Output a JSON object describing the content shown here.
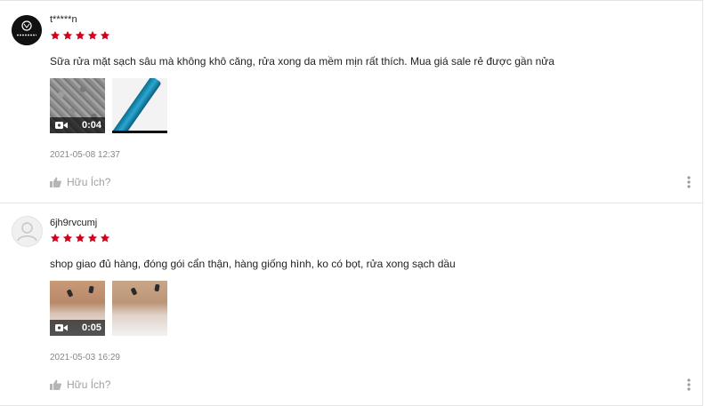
{
  "reviews": [
    {
      "username": "t*****n",
      "avatar_logo_text": "AN HOME",
      "rating": 5,
      "comment": "Sữa rửa mặt sạch sâu mà không khô căng, rửa xong da mềm mịn rất thích. Mua giá sale rẻ được gần nửa",
      "media": [
        {
          "type": "video",
          "duration": "0:04"
        },
        {
          "type": "image"
        }
      ],
      "timestamp": "2021-05-08 12:37",
      "helpful_label": "Hữu Ích?"
    },
    {
      "username": "6jh9rvcumj",
      "rating": 5,
      "comment": "shop giao đủ hàng,  đóng gói cẩn thận,   hàng giống hình, ko có bọt,  rửa xong sạch dầu",
      "media": [
        {
          "type": "video",
          "duration": "0:05"
        },
        {
          "type": "image"
        }
      ],
      "timestamp": "2021-05-03 16:29",
      "helpful_label": "Hữu Ích?"
    }
  ],
  "colors": {
    "star": "#d0011b",
    "text": "#222222",
    "muted": "#888888",
    "helpful": "#a0a0a0"
  },
  "icons": [
    "star-icon",
    "video-camera-icon",
    "thumbs-up-icon",
    "more-vertical-icon",
    "default-avatar-icon"
  ]
}
